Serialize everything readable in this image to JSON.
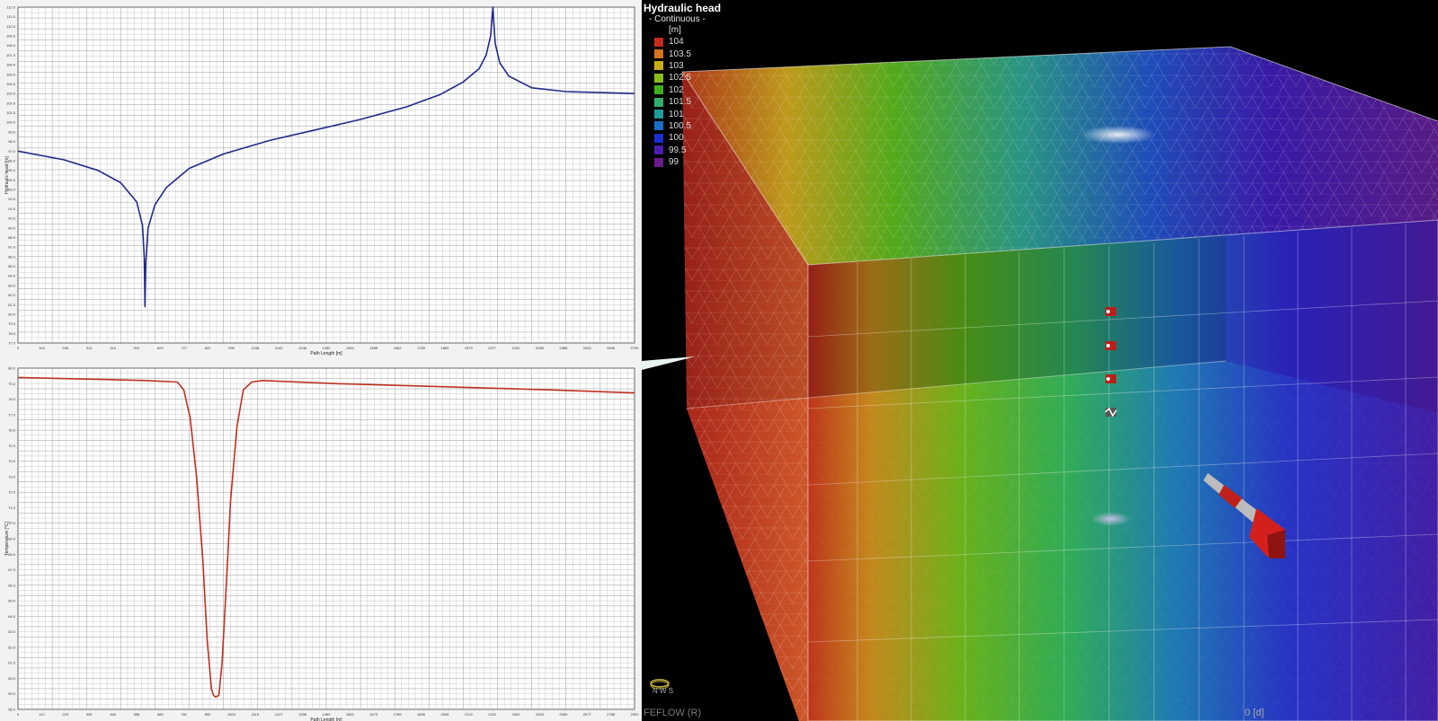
{
  "scene": {
    "legend": {
      "title": "Hydraulic head",
      "mode": "- Continuous -",
      "unit": "[m]",
      "items": [
        {
          "label": "104",
          "color": "#c62a1c"
        },
        {
          "label": "103.5",
          "color": "#d4741c"
        },
        {
          "label": "103",
          "color": "#c9ad18"
        },
        {
          "label": "102.5",
          "color": "#88bb18"
        },
        {
          "label": "102",
          "color": "#3fae1e"
        },
        {
          "label": "101.5",
          "color": "#2fae6e"
        },
        {
          "label": "101",
          "color": "#1d9a9a"
        },
        {
          "label": "100.5",
          "color": "#1a6ec8"
        },
        {
          "label": "100",
          "color": "#1a2fd0"
        },
        {
          "label": "99.5",
          "color": "#4a1cb0"
        },
        {
          "label": "99",
          "color": "#6a1a8e"
        }
      ]
    },
    "brand": "FEFLOW (R)",
    "time_label": "0 [d]",
    "compass_label": "N S W"
  },
  "chart_data": [
    {
      "type": "line",
      "title": "",
      "xlabel": "Path Length [m]",
      "ylabel": "Hydraulic head [m]",
      "xlim": [
        0,
        2700
      ],
      "ylim": [
        77,
        112
      ],
      "grid": true,
      "series": [
        {
          "color": "#1f2a8c",
          "x": [
            0,
            200,
            350,
            450,
            520,
            545,
            553,
            556,
            560,
            570,
            600,
            650,
            750,
            900,
            1100,
            1300,
            1500,
            1700,
            1850,
            1950,
            2020,
            2050,
            2070,
            2078,
            2080,
            2082,
            2090,
            2110,
            2150,
            2250,
            2400,
            2550,
            2700
          ],
          "y": [
            97.0,
            96.1,
            95.0,
            93.7,
            91.7,
            89.3,
            86.0,
            80.8,
            85.5,
            89.0,
            91.4,
            93.2,
            95.2,
            96.7,
            98.1,
            99.2,
            100.3,
            101.6,
            102.9,
            104.2,
            105.6,
            107.0,
            109.0,
            111.5,
            112.0,
            111.0,
            108.2,
            106.2,
            104.8,
            103.6,
            103.2,
            103.1,
            103.0
          ]
        }
      ]
    },
    {
      "type": "line",
      "title": "",
      "xlabel": "Path Length [m]",
      "ylabel": "Temperature [°C]",
      "xlim": [
        0,
        2900
      ],
      "ylim": [
        58,
        80
      ],
      "grid": true,
      "series": [
        {
          "color": "#c03020",
          "x": [
            0,
            300,
            600,
            750,
            780,
            810,
            840,
            870,
            890,
            910,
            920,
            930,
            945,
            960,
            980,
            1000,
            1030,
            1060,
            1100,
            1150,
            1500,
            2000,
            2500,
            2900
          ],
          "y": [
            79.4,
            79.3,
            79.2,
            79.1,
            78.6,
            76.8,
            73.0,
            67.5,
            62.5,
            59.3,
            58.9,
            58.8,
            58.9,
            61.0,
            66.0,
            71.5,
            76.2,
            78.6,
            79.1,
            79.2,
            79.0,
            78.8,
            78.6,
            78.4
          ]
        }
      ]
    }
  ]
}
